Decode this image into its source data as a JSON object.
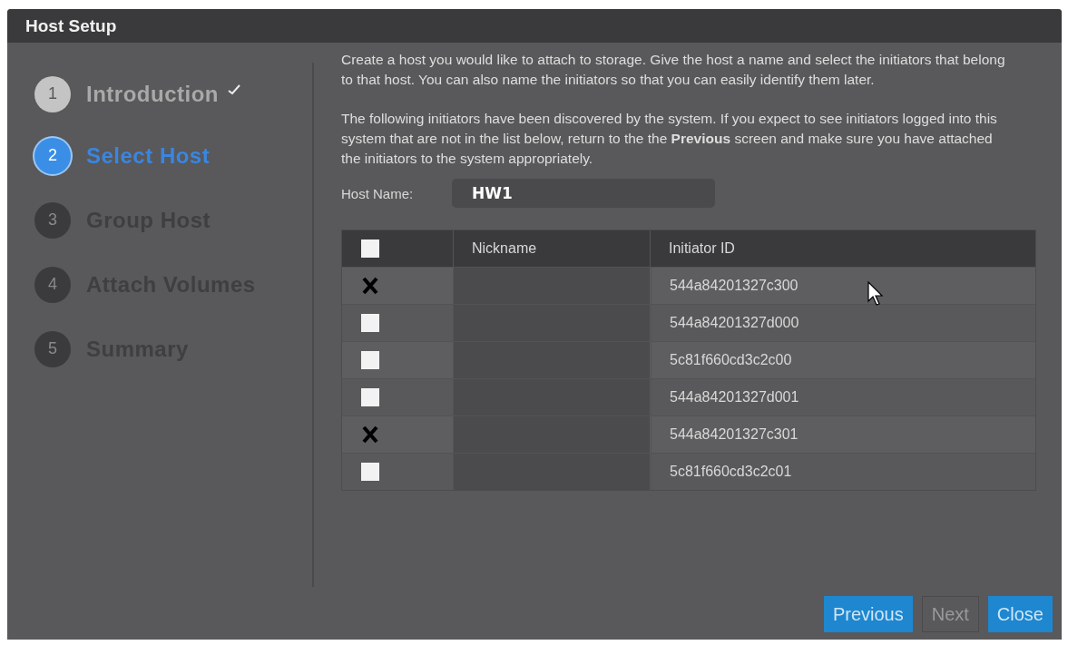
{
  "window": {
    "title": "Host Setup"
  },
  "steps": [
    {
      "number": "1",
      "label": "Introduction",
      "selected": false,
      "completed": true
    },
    {
      "number": "2",
      "label": "Select Host",
      "selected": true,
      "completed": false
    },
    {
      "number": "3",
      "label": "Group Host",
      "selected": false,
      "completed": false
    },
    {
      "number": "4",
      "label": "Attach Volumes",
      "selected": false,
      "completed": false
    },
    {
      "number": "5",
      "label": "Summary",
      "selected": false,
      "completed": false
    }
  ],
  "intro": "Create a host you would like to attach to storage. Give the host a name and select the initiators that belong to that host. You can also name the initiators so that you can easily identify them later.",
  "note": "The following initiators have been discovered by the system. If you expect to see initiators logged into this system that are not in the list below, return to the the **Previous** screen and make sure you have attached the initiators to the system appropriately.",
  "host_name": {
    "label": "Host Name:",
    "value": "HW1"
  },
  "table": {
    "select_all": {
      "checked": false
    },
    "columns": [
      "Nickname",
      "Initiator ID"
    ],
    "rows": [
      {
        "checked": true,
        "initiator_id": "544a84201327c300"
      },
      {
        "checked": false,
        "initiator_id": "544a84201327d000"
      },
      {
        "checked": false,
        "initiator_id": "5c81f660cd3c2c00"
      },
      {
        "checked": false,
        "initiator_id": "544a84201327d001"
      },
      {
        "checked": true,
        "initiator_id": "544a84201327c301"
      },
      {
        "checked": false,
        "initiator_id": "5c81f660cd3c2c01"
      }
    ]
  },
  "buttons": [
    {
      "label": "Previous",
      "disabled": false
    },
    {
      "label": "Next",
      "disabled": true
    },
    {
      "label": "Close",
      "disabled": false
    }
  ]
}
